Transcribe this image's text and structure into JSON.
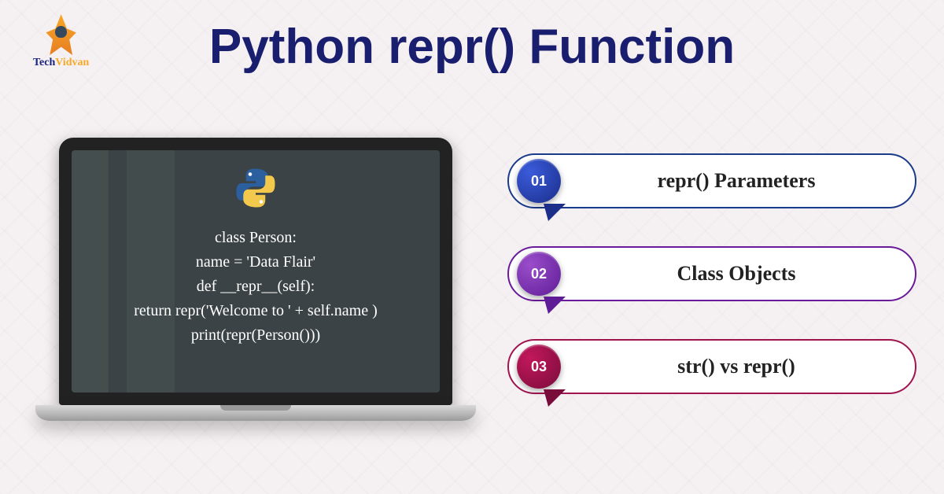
{
  "brand": {
    "name_part1": "Tech",
    "name_part2": "Vidvan"
  },
  "title": "Python repr() Function",
  "code_lines": [
    "class Person:",
    "name = 'Data Flair'",
    "def __repr__(self):",
    "return repr('Welcome to ' + self.name )",
    "print(repr(Person()))"
  ],
  "items": [
    {
      "num": "01",
      "label": "repr() Parameters",
      "color": "blue"
    },
    {
      "num": "02",
      "label": "Class Objects",
      "color": "purple"
    },
    {
      "num": "03",
      "label": "str() vs repr()",
      "color": "magenta"
    }
  ]
}
